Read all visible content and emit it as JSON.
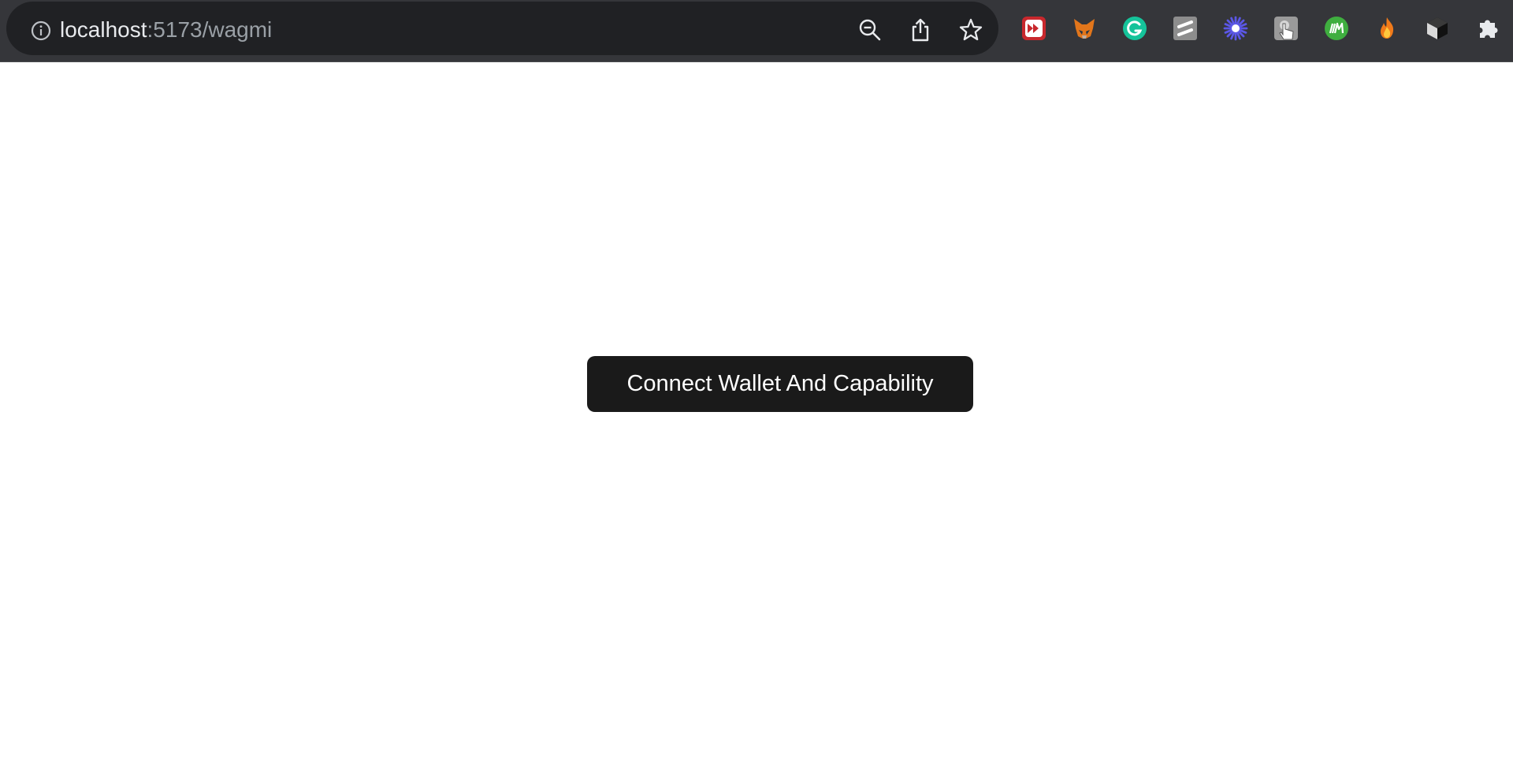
{
  "browser": {
    "url_host": "localhost",
    "url_path": ":5173/wagmi",
    "icons": {
      "site_info": "info-icon",
      "zoom": "zoom-out-icon",
      "share": "share-icon",
      "bookmark": "star-icon"
    },
    "extensions": [
      {
        "name": "fast-forward-extension-icon",
        "color": "#c8282d"
      },
      {
        "name": "metamask-fox-icon",
        "color": "#e2761b"
      },
      {
        "name": "grammarly-icon",
        "color": "#15c39a"
      },
      {
        "name": "slash-extension-icon",
        "color": "#8d8d8d"
      },
      {
        "name": "sun-burst-extension-icon",
        "color": "#5b57e6"
      },
      {
        "name": "touch-extension-icon",
        "color": "#9a9a9a"
      },
      {
        "name": "im-extension-icon",
        "color": "#3fae3f"
      },
      {
        "name": "flame-extension-icon",
        "color": "#f07a1a"
      },
      {
        "name": "cube-extension-icon",
        "color": "#111111"
      },
      {
        "name": "puzzle-extensions-icon",
        "color": "#e8eaed"
      }
    ]
  },
  "main": {
    "connect_button_label": "Connect Wallet And Capability"
  },
  "colors": {
    "toolbar_bg": "#35363a",
    "omnibox_bg": "#202124",
    "button_bg": "#1a1a1a",
    "button_text": "#ffffff"
  }
}
